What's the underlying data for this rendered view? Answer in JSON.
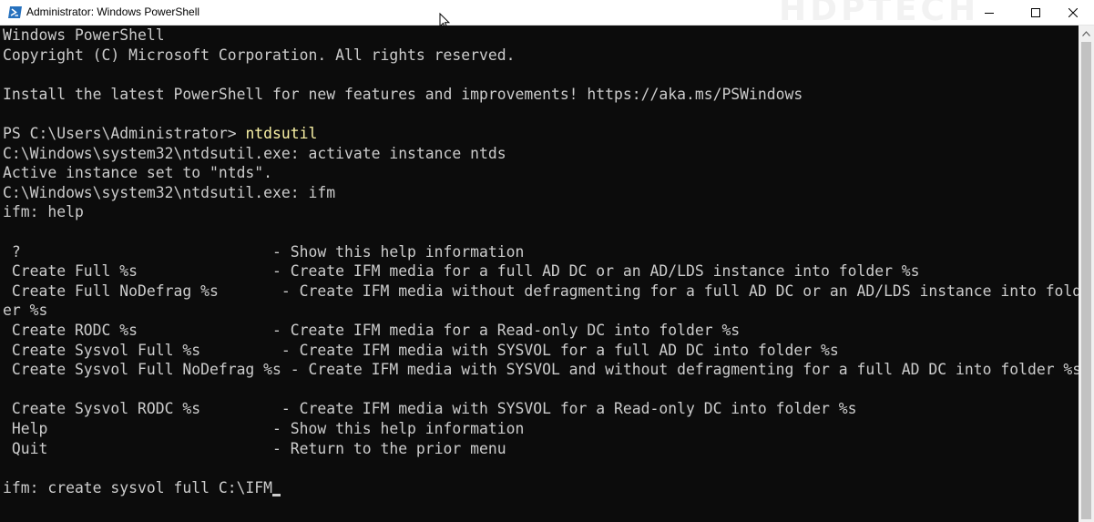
{
  "window": {
    "title": "Administrator: Windows PowerShell",
    "watermark": "HDPTECH"
  },
  "console": {
    "lines": [
      "Windows PowerShell",
      "Copyright (C) Microsoft Corporation. All rights reserved.",
      "",
      "Install the latest PowerShell for new features and improvements! https://aka.ms/PSWindows",
      "",
      "PS C:\\Users\\Administrator> ",
      "C:\\Windows\\system32\\ntdsutil.exe: activate instance ntds",
      "Active instance set to \"ntds\".",
      "C:\\Windows\\system32\\ntdsutil.exe: ifm",
      "ifm: help",
      "",
      " ?                            - Show this help information",
      " Create Full %s               - Create IFM media for a full AD DC or an AD/LDS instance into folder %s",
      " Create Full NoDefrag %s       - Create IFM media without defragmenting for a full AD DC or an AD/LDS instance into fold",
      "er %s",
      " Create RODC %s               - Create IFM media for a Read-only DC into folder %s",
      " Create Sysvol Full %s         - Create IFM media with SYSVOL for a full AD DC into folder %s",
      " Create Sysvol Full NoDefrag %s - Create IFM media with SYSVOL and without defragmenting for a full AD DC into folder %s",
      "",
      " Create Sysvol RODC %s         - Create IFM media with SYSVOL for a Read-only DC into folder %s",
      " Help                         - Show this help information",
      " Quit                         - Return to the prior menu",
      "",
      "ifm: create sysvol full C:\\IFM"
    ],
    "prompt_command": "ntdsutil",
    "colors": {
      "background": "#0c0c0c",
      "foreground": "#cccccc",
      "command": "#f9f1a5"
    }
  }
}
